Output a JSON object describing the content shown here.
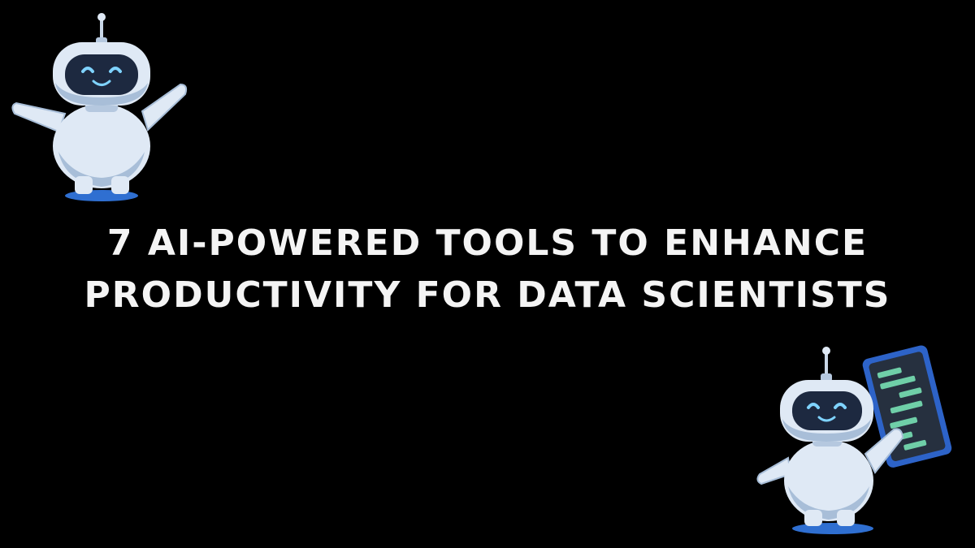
{
  "headline": {
    "line1": "7 AI-POWERED TOOLS TO ENHANCE",
    "line2": "PRODUCTIVITY FOR DATA SCIENTISTS"
  },
  "colors": {
    "background": "#000000",
    "text": "#f4f4f4",
    "robot_body": "#dfe9f5",
    "robot_shade": "#a8bed8",
    "robot_visor": "#1d2940",
    "robot_eyes": "#7fd3ff",
    "shadow": "#2f6fd1",
    "tablet_frame": "#2d63c8",
    "tablet_screen": "#26303f",
    "tablet_lines": "#6fcfa8"
  },
  "icons": {
    "robot_left": "waving-robot-icon",
    "robot_right": "robot-holding-tablet-icon"
  }
}
